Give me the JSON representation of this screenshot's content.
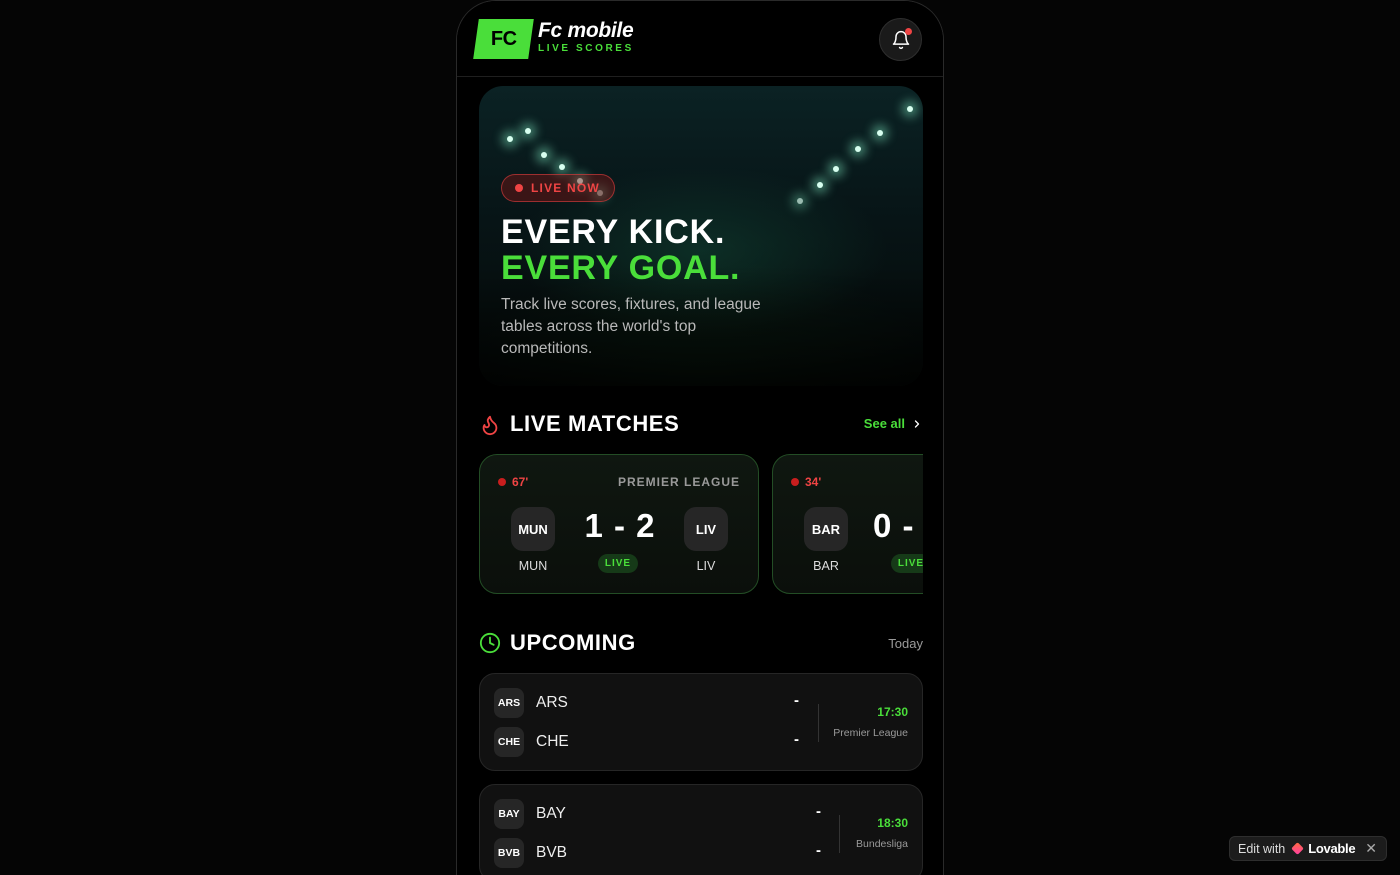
{
  "app": {
    "logo_text": "FC",
    "name": "Fc mobile",
    "subtitle": "LIVE SCORES"
  },
  "hero": {
    "badge": "LIVE NOW",
    "headline_1": "EVERY KICK.",
    "headline_2": "EVERY GOAL.",
    "description": "Track live scores, fixtures, and league tables across the world's top competitions."
  },
  "live_section": {
    "title": "LIVE MATCHES",
    "see_all": "See all",
    "matches": [
      {
        "minute": "67'",
        "league": "PREMIER LEAGUE",
        "home": "MUN",
        "home_name": "MUN",
        "away": "LIV",
        "away_name": "LIV",
        "score": "1 - 2",
        "status": "LIVE"
      },
      {
        "minute": "34'",
        "league": "",
        "home": "BAR",
        "home_name": "BAR",
        "score": "0 -",
        "status": "LIVE"
      }
    ]
  },
  "upcoming_section": {
    "title": "UPCOMING",
    "filter": "Today",
    "fixtures": [
      {
        "home": "ARS",
        "home_name": "ARS",
        "away": "CHE",
        "away_name": "CHE",
        "home_score": "-",
        "away_score": "-",
        "time": "17:30",
        "league": "Premier League"
      },
      {
        "home": "BAY",
        "home_name": "BAY",
        "away": "BVB",
        "away_name": "BVB",
        "home_score": "-",
        "away_score": "-",
        "time": "18:30",
        "league": "Bundesliga"
      }
    ]
  },
  "lovable_badge": {
    "edit_with": "Edit with",
    "brand": "Lovable",
    "close": "✕"
  },
  "colors": {
    "accent": "#4ade3a",
    "live": "#ef4444",
    "background": "#000000"
  }
}
